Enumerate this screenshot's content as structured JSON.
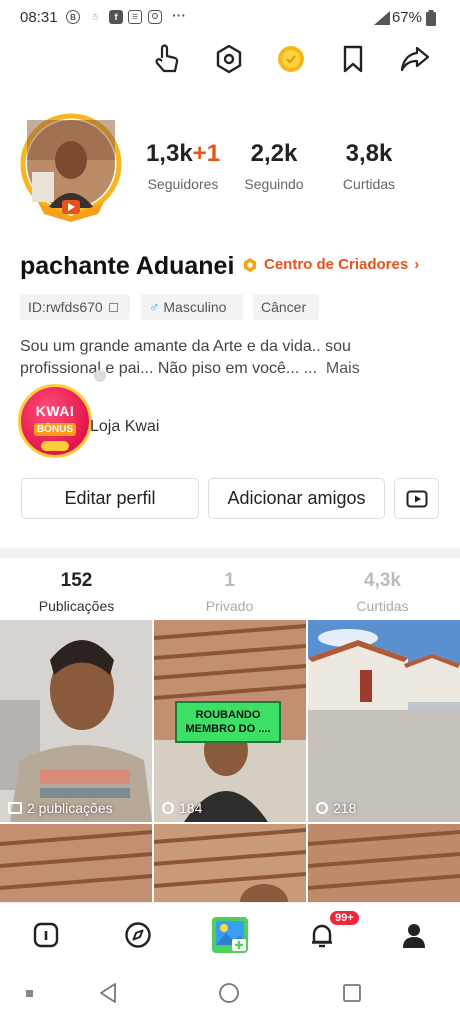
{
  "status_bar": {
    "time": "08:31",
    "battery": "67%",
    "notification_icons": [
      "b-icon",
      "app-icon",
      "facebook-icon",
      "chat-icon",
      "instagram-icon",
      "more-dots-icon"
    ]
  },
  "top_actions": [
    "hand-pointer-icon",
    "hexagon-settings-icon",
    "coin-icon",
    "bookmark-icon",
    "share-icon"
  ],
  "profile": {
    "stats": [
      {
        "value": "1,3k",
        "extra": "+1",
        "label": "Seguidores"
      },
      {
        "value": "2,2k",
        "extra": "",
        "label": "Seguindo"
      },
      {
        "value": "3,8k",
        "extra": "",
        "label": "Curtidas"
      }
    ],
    "name": "pachante Aduanei",
    "creator_center": "Centro de Criadores",
    "tags": {
      "id": "ID:rwfds670",
      "gender": "Masculino",
      "sign": "Câncer"
    },
    "bio_line1": "Sou um grande amante da Arte e da vida.. sou",
    "bio_line2": "profissional e pai... Não piso em você... ...",
    "bio_more": "Mais",
    "bonus_title": "KWAI",
    "bonus_sub": "BÔNUS",
    "shop_label": "Loja Kwai"
  },
  "buttons": {
    "edit": "Editar perfil",
    "add_friends": "Adicionar amigos"
  },
  "tabs": [
    {
      "count": "152",
      "label": "Publicações"
    },
    {
      "count": "1",
      "label": "Privado"
    },
    {
      "count": "4,3k",
      "label": "Curtidas"
    }
  ],
  "grid": [
    {
      "overlay": "2 publicações"
    },
    {
      "overlay": "184",
      "caption": "ROUBANDO\nMEMBRO DO ...."
    },
    {
      "overlay": "218"
    }
  ],
  "bottom_nav": {
    "badge": "99+"
  },
  "colors": {
    "accent": "#e8531b",
    "badge": "#f2263a"
  }
}
